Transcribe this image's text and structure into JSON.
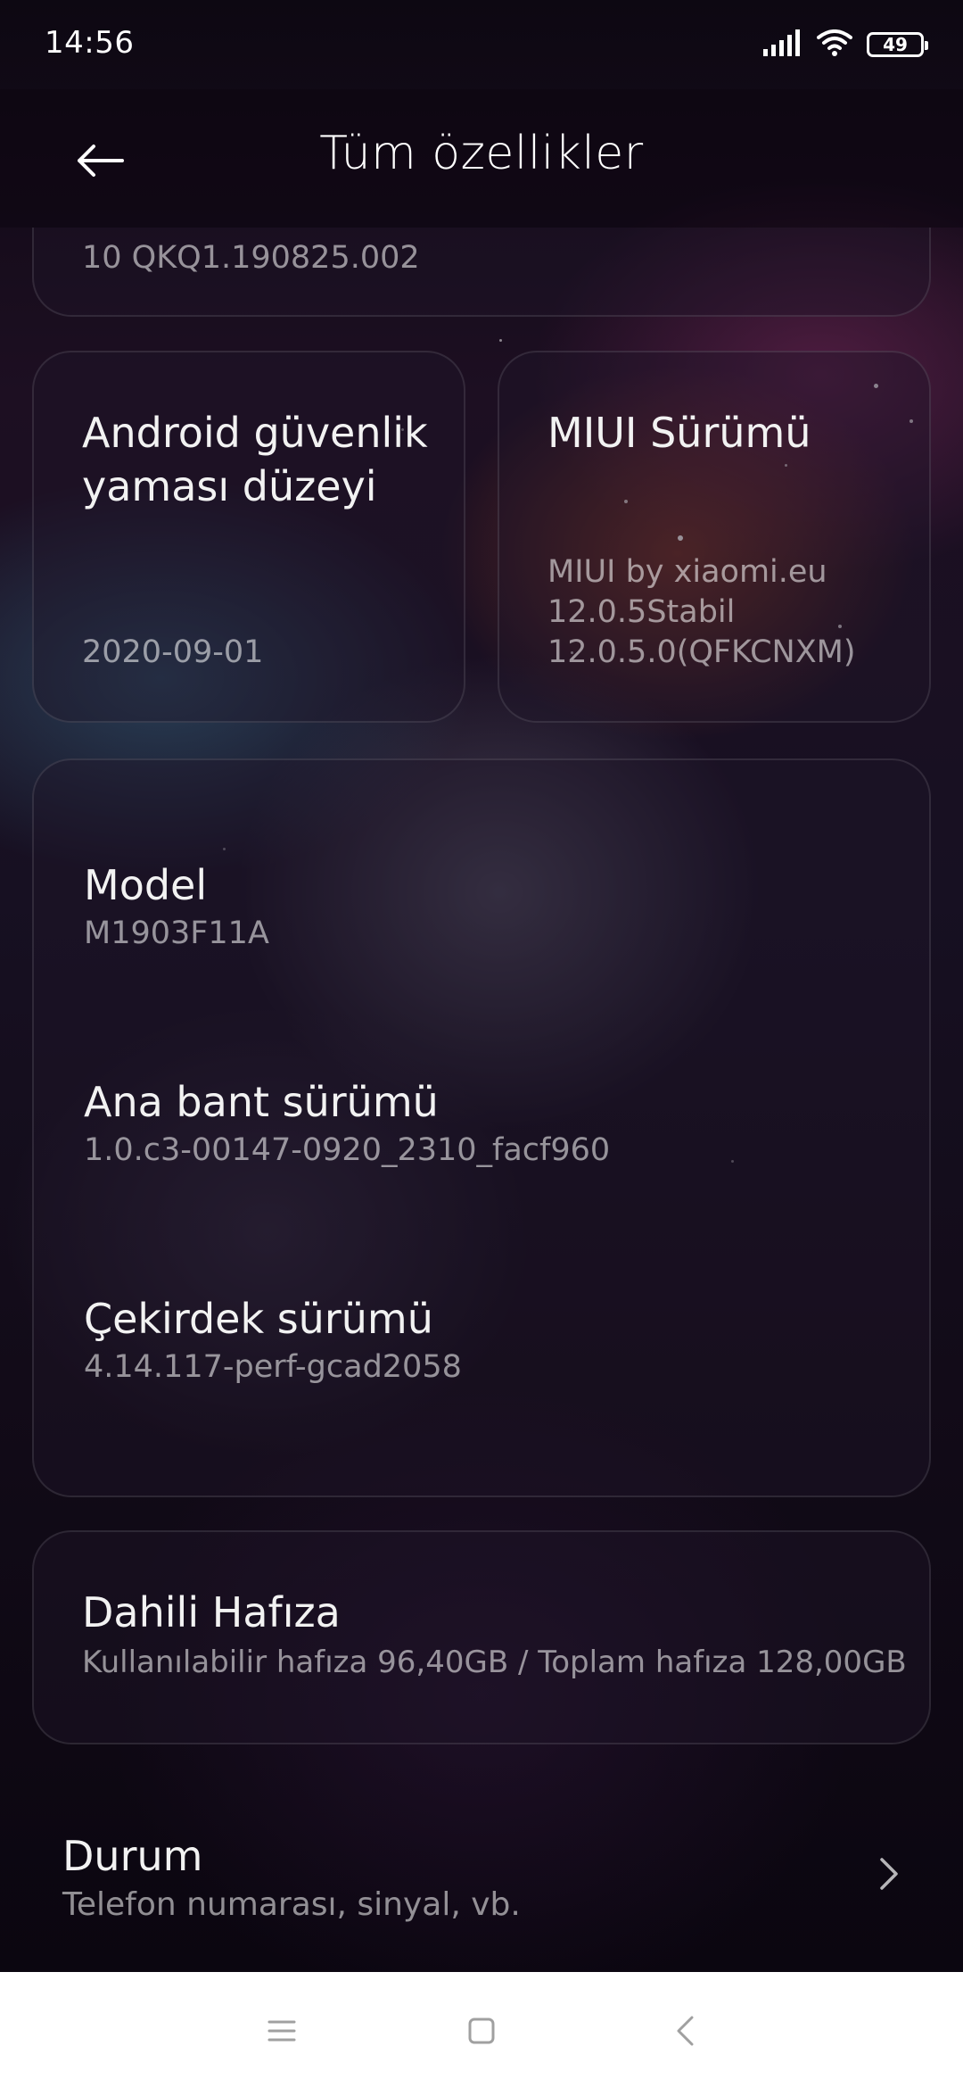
{
  "status_bar": {
    "time": "14:56",
    "battery_level": "49",
    "signal_icon": "signal-bars-icon",
    "wifi_icon": "wifi-icon"
  },
  "header": {
    "title": "Tüm özellikler",
    "back_icon": "back-arrow-icon"
  },
  "android_version_card": {
    "value": "10 QKQ1.190825.002"
  },
  "security_patch_card": {
    "title": "Android güvenlik yaması düzeyi",
    "value": "2020-09-01"
  },
  "miui_card": {
    "title": "MIUI Sürümü",
    "value_lines": [
      "MIUI by xiaomi.eu",
      "12.0.5Stabil",
      "12.0.5.0(QFKCNXM)"
    ]
  },
  "info_card": {
    "items": [
      {
        "title": "Model",
        "value": "M1903F11A"
      },
      {
        "title": "Ana bant sürümü",
        "value": "1.0.c3-00147-0920_2310_facf960"
      },
      {
        "title": "Çekirdek sürümü",
        "value": "4.14.117-perf-gcad2058"
      }
    ]
  },
  "storage_card": {
    "title": "Dahili Hafıza",
    "value": "Kullanılabilir hafıza 96,40GB / Toplam hafıza 128,00GB"
  },
  "status_row": {
    "title": "Durum",
    "subtitle": "Telefon numarası, sinyal, vb.",
    "chevron_icon": "chevron-right-icon"
  },
  "nav_bar": {
    "menu_icon": "menu-icon",
    "home_icon": "home-square-icon",
    "back_icon": "back-triangle-icon"
  },
  "colors": {
    "background": "#0c0710",
    "text_primary": "#ffffff",
    "text_secondary": "#8f8a95",
    "nav_bar": "#ffffff"
  }
}
